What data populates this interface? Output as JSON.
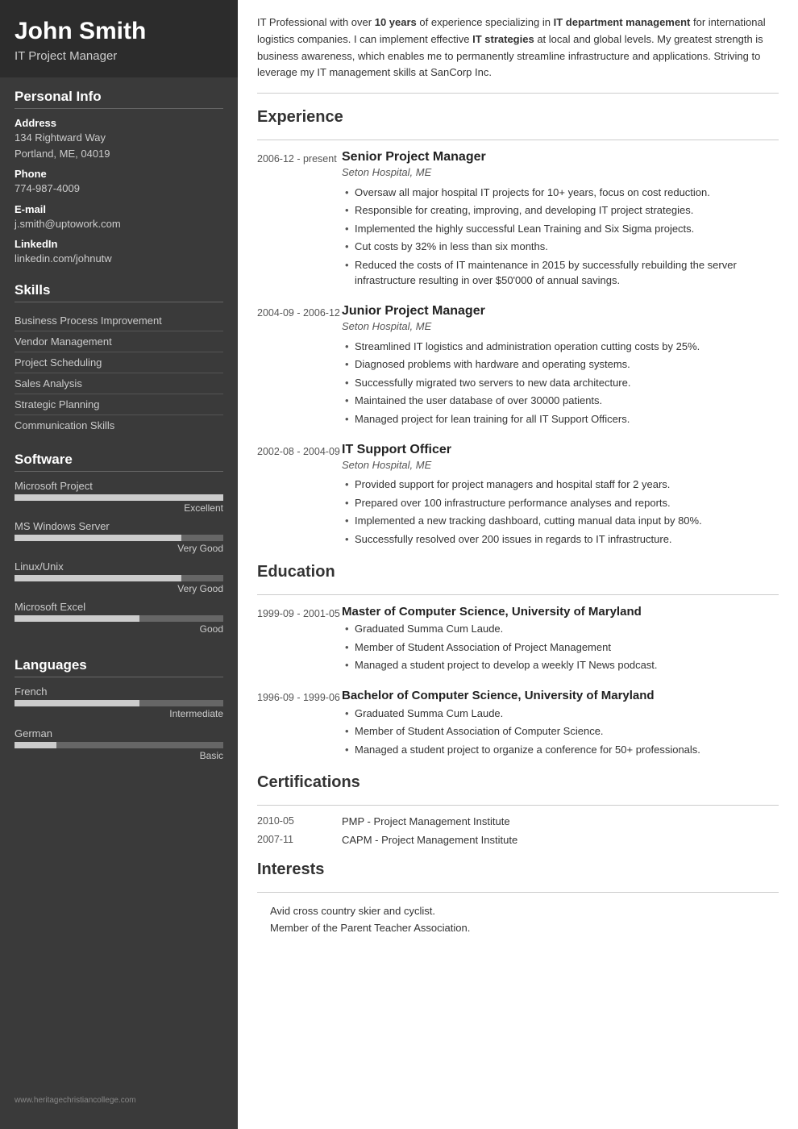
{
  "sidebar": {
    "name": "John Smith",
    "title": "IT Project Manager",
    "personal_info": {
      "label": "Personal Info",
      "address_label": "Address",
      "address_line1": "134 Rightward Way",
      "address_line2": "Portland, ME, 04019",
      "phone_label": "Phone",
      "phone": "774-987-4009",
      "email_label": "E-mail",
      "email": "j.smith@uptowork.com",
      "linkedin_label": "LinkedIn",
      "linkedin": "linkedin.com/johnutw"
    },
    "skills": {
      "label": "Skills",
      "items": [
        "Business Process Improvement",
        "Vendor Management",
        "Project Scheduling",
        "Sales Analysis",
        "Strategic Planning",
        "Communication Skills"
      ]
    },
    "software": {
      "label": "Software",
      "items": [
        {
          "name": "Microsoft Project",
          "pct": 100,
          "rating": "Excellent"
        },
        {
          "name": "MS Windows Server",
          "pct": 80,
          "rating": "Very Good"
        },
        {
          "name": "Linux/Unix",
          "pct": 80,
          "rating": "Very Good"
        },
        {
          "name": "Microsoft Excel",
          "pct": 60,
          "rating": "Good"
        }
      ]
    },
    "languages": {
      "label": "Languages",
      "items": [
        {
          "name": "French",
          "pct": 60,
          "rating": "Intermediate"
        },
        {
          "name": "German",
          "pct": 20,
          "rating": "Basic"
        }
      ]
    },
    "footer": "www.heritagechristiancollege.com"
  },
  "main": {
    "summary": "IT Professional with over 10 years of experience specializing in IT department management for international logistics companies. I can implement effective IT strategies at local and global levels. My greatest strength is business awareness, which enables me to permanently streamline infrastructure and applications. Striving to leverage my IT management skills at SanCorp Inc.",
    "experience": {
      "label": "Experience",
      "entries": [
        {
          "date": "2006-12 - present",
          "title": "Senior Project Manager",
          "company": "Seton Hospital, ME",
          "bullets": [
            "Oversaw all major hospital IT projects for 10+ years, focus on cost reduction.",
            "Responsible for creating, improving, and developing IT project strategies.",
            "Implemented the highly successful Lean Training and Six Sigma projects.",
            "Cut costs by 32% in less than six months.",
            "Reduced the costs of IT maintenance in 2015 by successfully rebuilding the server infrastructure resulting in over $50'000 of annual savings."
          ]
        },
        {
          "date": "2004-09 - 2006-12",
          "title": "Junior Project Manager",
          "company": "Seton Hospital, ME",
          "bullets": [
            "Streamlined IT logistics and administration operation cutting costs by 25%.",
            "Diagnosed problems with hardware and operating systems.",
            "Successfully migrated two servers to new data architecture.",
            "Maintained the user database of over 30000 patients.",
            "Managed project for lean training for all IT Support Officers."
          ]
        },
        {
          "date": "2002-08 - 2004-09",
          "title": "IT Support Officer",
          "company": "Seton Hospital, ME",
          "bullets": [
            "Provided support for project managers and hospital staff for 2 years.",
            "Prepared over 100 infrastructure performance analyses and reports.",
            "Implemented a new tracking dashboard, cutting manual data input by 80%.",
            "Successfully resolved over 200 issues in regards to IT infrastructure."
          ]
        }
      ]
    },
    "education": {
      "label": "Education",
      "entries": [
        {
          "date": "1999-09 - 2001-05",
          "title": "Master of Computer Science, University of Maryland",
          "bullets": [
            "Graduated Summa Cum Laude.",
            "Member of Student Association of Project Management",
            "Managed a student project to develop a weekly IT News podcast."
          ]
        },
        {
          "date": "1996-09 - 1999-06",
          "title": "Bachelor of Computer Science, University of Maryland",
          "bullets": [
            "Graduated Summa Cum Laude.",
            "Member of Student Association of Computer Science.",
            "Managed a student project to organize a conference for 50+ professionals."
          ]
        }
      ]
    },
    "certifications": {
      "label": "Certifications",
      "entries": [
        {
          "date": "2010-05",
          "name": "PMP - Project Management Institute"
        },
        {
          "date": "2007-11",
          "name": "CAPM - Project Management Institute"
        }
      ]
    },
    "interests": {
      "label": "Interests",
      "items": [
        "Avid cross country skier and cyclist.",
        "Member of the Parent Teacher Association."
      ]
    }
  }
}
